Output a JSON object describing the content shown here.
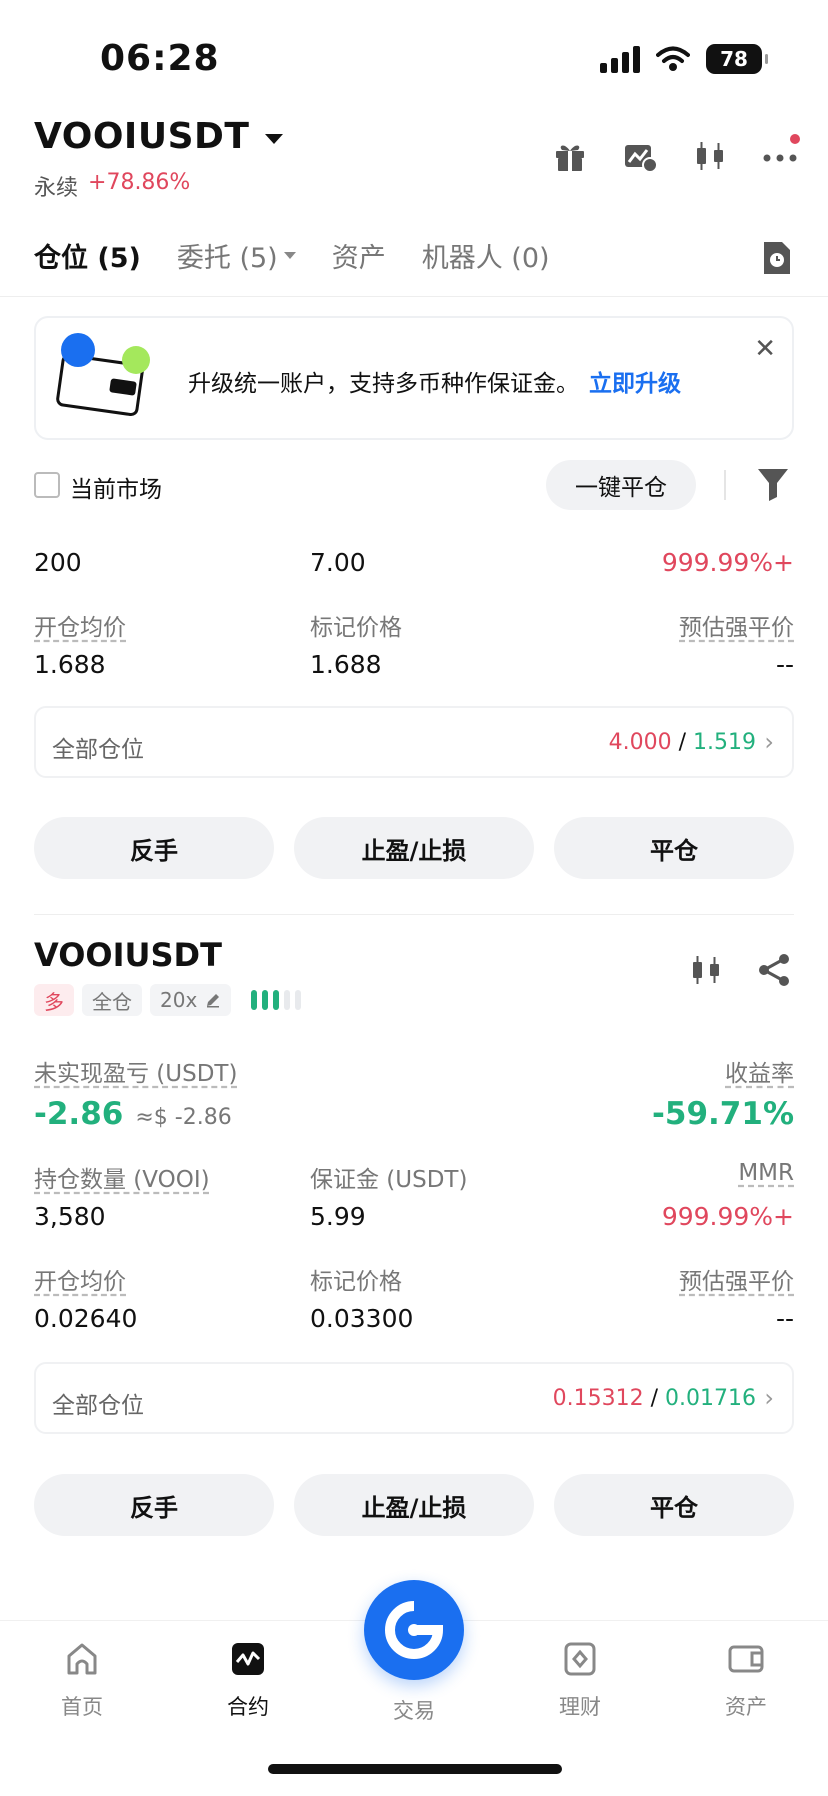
{
  "status": {
    "time": "06:28",
    "battery": "78"
  },
  "header": {
    "pair": "VOOIUSDT",
    "type": "永续",
    "change": "+78.86%"
  },
  "tabs": [
    {
      "label": "仓位 (5)"
    },
    {
      "label": "委托 (5)"
    },
    {
      "label": "资产"
    },
    {
      "label": "机器人 (0)"
    }
  ],
  "banner": {
    "text": "升级统一账户，支持多币种作保证金。",
    "link": "立即升级"
  },
  "filter": {
    "current_market": "当前市场",
    "close_all": "一键平仓"
  },
  "position1": {
    "qty": "200",
    "margin": "7.00",
    "mmr": "999.99%+",
    "entry_label": "开仓均价",
    "entry": "1.688",
    "mark_label": "标记价格",
    "mark": "1.688",
    "liq_label": "预估强平价",
    "liq": "--",
    "all_label": "全部仓位",
    "all_a": "4.000",
    "all_sep": "/",
    "all_b": "1.519"
  },
  "position2": {
    "pair": "VOOIUSDT",
    "side": "多",
    "mode": "全仓",
    "leverage": "20x",
    "upnl_label": "未实现盈亏 (USDT)",
    "upnl": "-2.86",
    "upnl_usd": "≈$ -2.86",
    "roe_label": "收益率",
    "roe": "-59.71%",
    "qty_label": "持仓数量 (VOOI)",
    "qty": "3,580",
    "margin_label": "保证金 (USDT)",
    "margin": "5.99",
    "mmr_label": "MMR",
    "mmr": "999.99%+",
    "entry_label": "开仓均价",
    "entry": "0.02640",
    "mark_label": "标记价格",
    "mark": "0.03300",
    "liq_label": "预估强平价",
    "liq": "--",
    "all_label": "全部仓位",
    "all_a": "0.15312",
    "all_sep": "/",
    "all_b": "0.01716"
  },
  "buttons": {
    "reverse": "反手",
    "tpsl": "止盈/止损",
    "close": "平仓"
  },
  "nav": [
    {
      "label": "首页"
    },
    {
      "label": "合约"
    },
    {
      "label": "交易"
    },
    {
      "label": "理财"
    },
    {
      "label": "资产"
    }
  ],
  "colors": {
    "up": "#e0475d",
    "down": "#22b07d",
    "accent": "#1a6ff0"
  }
}
